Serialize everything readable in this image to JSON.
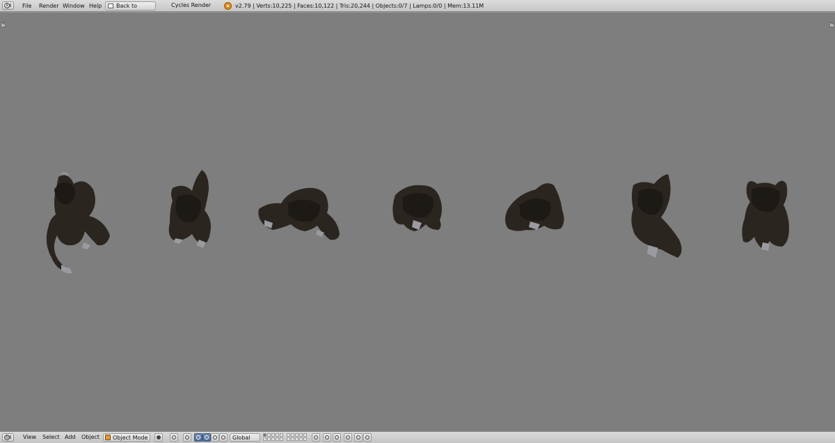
{
  "top_header": {
    "menus": [
      "File",
      "Render",
      "Window",
      "Help"
    ],
    "back_button": "Back to Previous",
    "render_engine": "Cycles Render",
    "stats": "v2.79 | Verts:10,225 | Faces:10,122 | Tris:20,244 | Objects:0/7 | Lamps:0/0 | Mem:13.11M"
  },
  "bottom_header": {
    "menus": [
      "View",
      "Select",
      "Add",
      "Object"
    ],
    "mode": "Object Mode",
    "orientation": "Global"
  },
  "icons": {
    "editor_type": "info-icon",
    "engine_logo": "blender-logo-icon",
    "viewport_shading": "solid-sphere-icon",
    "pivot": "pivot-point-icon",
    "manipulator": "manipulator-icon",
    "translate": "translate-arrow-icon",
    "rotate": "rotate-icon",
    "scale": "scale-icon",
    "snap": "magnet-icon",
    "render": "camera-icon"
  },
  "colors": {
    "viewport_bg": "#7e7e7e",
    "header_bg": "#d0d0d0",
    "fur": "#2b2520",
    "fur_dark": "#1d1915",
    "skin": "#9a9aa0",
    "accent_blue": "#5477a3",
    "object_orange": "#e09a33"
  }
}
